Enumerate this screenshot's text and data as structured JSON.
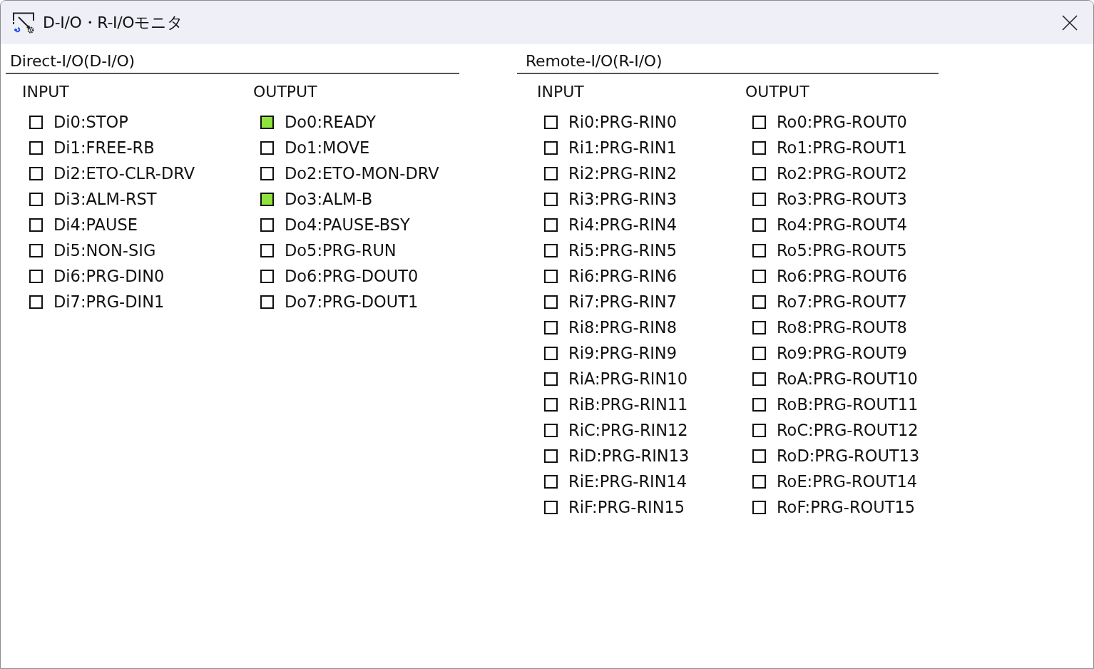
{
  "window": {
    "title": "D-I/O・R-I/Oモニタ"
  },
  "groups": [
    {
      "title": "Direct-I/O(D-I/O)",
      "columns": [
        {
          "heading": "INPUT",
          "signals": [
            {
              "label": "Di0:STOP",
              "on": false
            },
            {
              "label": "Di1:FREE-RB",
              "on": false
            },
            {
              "label": "Di2:ETO-CLR-DRV",
              "on": false
            },
            {
              "label": "Di3:ALM-RST",
              "on": false
            },
            {
              "label": "Di4:PAUSE",
              "on": false
            },
            {
              "label": "Di5:NON-SIG",
              "on": false
            },
            {
              "label": "Di6:PRG-DIN0",
              "on": false
            },
            {
              "label": "Di7:PRG-DIN1",
              "on": false
            }
          ]
        },
        {
          "heading": "OUTPUT",
          "signals": [
            {
              "label": "Do0:READY",
              "on": true
            },
            {
              "label": "Do1:MOVE",
              "on": false
            },
            {
              "label": "Do2:ETO-MON-DRV",
              "on": false
            },
            {
              "label": "Do3:ALM-B",
              "on": true
            },
            {
              "label": "Do4:PAUSE-BSY",
              "on": false
            },
            {
              "label": "Do5:PRG-RUN",
              "on": false
            },
            {
              "label": "Do6:PRG-DOUT0",
              "on": false
            },
            {
              "label": "Do7:PRG-DOUT1",
              "on": false
            }
          ]
        }
      ]
    },
    {
      "title": "Remote-I/O(R-I/O)",
      "columns": [
        {
          "heading": "INPUT",
          "signals": [
            {
              "label": "Ri0:PRG-RIN0",
              "on": false
            },
            {
              "label": "Ri1:PRG-RIN1",
              "on": false
            },
            {
              "label": "Ri2:PRG-RIN2",
              "on": false
            },
            {
              "label": "Ri3:PRG-RIN3",
              "on": false
            },
            {
              "label": "Ri4:PRG-RIN4",
              "on": false
            },
            {
              "label": "Ri5:PRG-RIN5",
              "on": false
            },
            {
              "label": "Ri6:PRG-RIN6",
              "on": false
            },
            {
              "label": "Ri7:PRG-RIN7",
              "on": false
            },
            {
              "label": "Ri8:PRG-RIN8",
              "on": false
            },
            {
              "label": "Ri9:PRG-RIN9",
              "on": false
            },
            {
              "label": "RiA:PRG-RIN10",
              "on": false
            },
            {
              "label": "RiB:PRG-RIN11",
              "on": false
            },
            {
              "label": "RiC:PRG-RIN12",
              "on": false
            },
            {
              "label": "RiD:PRG-RIN13",
              "on": false
            },
            {
              "label": "RiE:PRG-RIN14",
              "on": false
            },
            {
              "label": "RiF:PRG-RIN15",
              "on": false
            }
          ]
        },
        {
          "heading": "OUTPUT",
          "signals": [
            {
              "label": "Ro0:PRG-ROUT0",
              "on": false
            },
            {
              "label": "Ro1:PRG-ROUT1",
              "on": false
            },
            {
              "label": "Ro2:PRG-ROUT2",
              "on": false
            },
            {
              "label": "Ro3:PRG-ROUT3",
              "on": false
            },
            {
              "label": "Ro4:PRG-ROUT4",
              "on": false
            },
            {
              "label": "Ro5:PRG-ROUT5",
              "on": false
            },
            {
              "label": "Ro6:PRG-ROUT6",
              "on": false
            },
            {
              "label": "Ro7:PRG-ROUT7",
              "on": false
            },
            {
              "label": "Ro8:PRG-ROUT8",
              "on": false
            },
            {
              "label": "Ro9:PRG-ROUT9",
              "on": false
            },
            {
              "label": "RoA:PRG-ROUT10",
              "on": false
            },
            {
              "label": "RoB:PRG-ROUT11",
              "on": false
            },
            {
              "label": "RoC:PRG-ROUT12",
              "on": false
            },
            {
              "label": "RoD:PRG-ROUT13",
              "on": false
            },
            {
              "label": "RoE:PRG-ROUT14",
              "on": false
            },
            {
              "label": "RoF:PRG-ROUT15",
              "on": false
            }
          ]
        }
      ]
    }
  ]
}
